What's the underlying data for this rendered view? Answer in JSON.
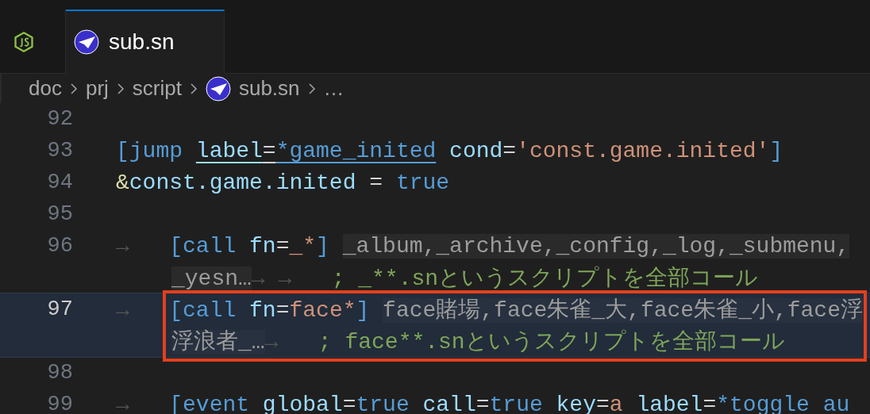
{
  "tabs": [
    {
      "kind": "js",
      "selected": false
    },
    {
      "kind": "sn",
      "label": "sub.sn",
      "selected": true
    }
  ],
  "breadcrumb": [
    {
      "label": "doc"
    },
    {
      "label": "prj"
    },
    {
      "label": "script"
    },
    {
      "label": "sub.sn",
      "kind": "sn"
    },
    {
      "label": "…"
    }
  ],
  "lines": [
    {
      "number": "92",
      "current": false,
      "flagged": false
    },
    {
      "number": "93",
      "current": false,
      "flagged": false,
      "visual_lines": [
        {
          "tokens": [
            {
              "kind": "b",
              "t": "["
            },
            {
              "kind": "tag",
              "t": "jump "
            },
            {
              "kind": "attr",
              "t": "label",
              "u": true
            },
            {
              "kind": "op",
              "t": "=",
              "u": true
            },
            {
              "kind": "lab",
              "t": "*game_inited",
              "u": true
            },
            {
              "kind": "attr",
              "t": " cond"
            },
            {
              "kind": "op",
              "t": "="
            },
            {
              "kind": "str",
              "t": "'const.game.inited'"
            },
            {
              "kind": "b",
              "t": "]"
            }
          ]
        }
      ]
    },
    {
      "number": "94",
      "current": false,
      "flagged": false,
      "visual_lines": [
        {
          "tokens": [
            {
              "kind": "amp",
              "t": "&"
            },
            {
              "kind": "attr",
              "t": "const.game.inited"
            },
            {
              "kind": "op",
              "t": " = "
            },
            {
              "kind": "tag",
              "t": "true"
            }
          ]
        }
      ]
    },
    {
      "number": "95",
      "current": false,
      "flagged": false
    },
    {
      "number": "96",
      "current": false,
      "flagged": false,
      "visual_lines": [
        {
          "tokens": [
            {
              "kind": "ws",
              "t": "→   "
            },
            {
              "kind": "b",
              "t": "["
            },
            {
              "kind": "tag",
              "t": "call "
            },
            {
              "kind": "attr",
              "t": "fn"
            },
            {
              "kind": "op",
              "t": "="
            },
            {
              "kind": "str",
              "t": "_*"
            },
            {
              "kind": "b",
              "t": "] "
            },
            {
              "kind": "fold",
              "t": "_album,_archive,_config,_log,_submenu,"
            }
          ]
        },
        {
          "tokens": [
            {
              "kind": "fold",
              "t": "_yesn…"
            },
            {
              "kind": "ws",
              "t": "→ →   "
            },
            {
              "kind": "cmt",
              "t": "; _**.snというスクリプトを全部コール"
            }
          ]
        }
      ]
    },
    {
      "number": "97",
      "current": true,
      "flagged": true,
      "visual_lines": [
        {
          "tokens": [
            {
              "kind": "ws",
              "t": "→   "
            },
            {
              "kind": "b",
              "t": "["
            },
            {
              "kind": "tag",
              "t": "call "
            },
            {
              "kind": "attr",
              "t": "fn"
            },
            {
              "kind": "op",
              "t": "="
            },
            {
              "kind": "str",
              "t": "face*"
            },
            {
              "kind": "b",
              "t": "] "
            },
            {
              "kind": "fold",
              "t": "face賭場,face朱雀_大,face朱雀_小,face浮"
            }
          ]
        },
        {
          "tokens": [
            {
              "kind": "fold",
              "t": "浮浪者_…"
            },
            {
              "kind": "ws",
              "t": "→   "
            },
            {
              "kind": "cmt",
              "t": "; face**.snというスクリプトを全部コール"
            }
          ]
        }
      ]
    },
    {
      "number": "98",
      "current": false,
      "flagged": false
    },
    {
      "number": "99",
      "current": false,
      "flagged": false,
      "visual_lines": [
        {
          "tokens": [
            {
              "kind": "ws",
              "t": "→   "
            },
            {
              "kind": "b",
              "t": "["
            },
            {
              "kind": "tag",
              "t": "event "
            },
            {
              "kind": "attr",
              "t": "global"
            },
            {
              "kind": "op",
              "t": "="
            },
            {
              "kind": "tag",
              "t": "true "
            },
            {
              "kind": "attr",
              "t": "call"
            },
            {
              "kind": "op",
              "t": "="
            },
            {
              "kind": "tag",
              "t": "true "
            },
            {
              "kind": "attr",
              "t": "key"
            },
            {
              "kind": "op",
              "t": "="
            },
            {
              "kind": "str",
              "t": "a "
            },
            {
              "kind": "attr",
              "t": "label"
            },
            {
              "kind": "op",
              "t": "="
            },
            {
              "kind": "lab",
              "t": "*toggle au"
            }
          ]
        }
      ]
    }
  ]
}
